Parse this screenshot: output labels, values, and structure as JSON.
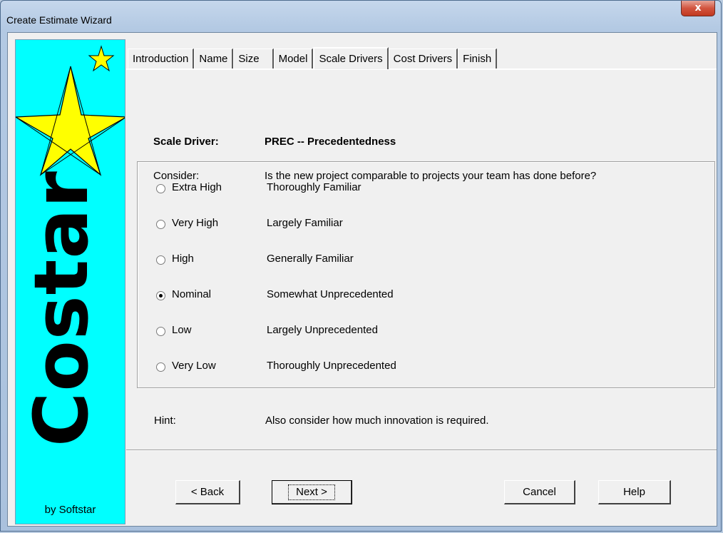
{
  "window": {
    "title": "Create Estimate Wizard",
    "close_glyph": "x"
  },
  "sidebar": {
    "brand": "Costar",
    "byline": "by Softstar",
    "logo_icon": "star-icon",
    "background": "#00ffff",
    "star_color": "#ffff00"
  },
  "tabs": [
    {
      "label": "Introduction"
    },
    {
      "label": "Name"
    },
    {
      "label": "Size"
    },
    {
      "label": "Model"
    },
    {
      "label": "Scale Drivers"
    },
    {
      "label": "Cost Drivers"
    },
    {
      "label": "Finish"
    }
  ],
  "active_tab": "Scale Drivers",
  "driver": {
    "label": "Scale Driver:",
    "value": "PREC -- Precedentedness",
    "consider_label": "Consider:",
    "consider_text": "Is the new project comparable to projects your team has done before?"
  },
  "options": [
    {
      "level": "Extra High",
      "description": "Thoroughly Familiar",
      "checked": false
    },
    {
      "level": "Very High",
      "description": "Largely Familiar",
      "checked": false
    },
    {
      "level": "High",
      "description": "Generally Familiar",
      "checked": false
    },
    {
      "level": "Nominal",
      "description": "Somewhat Unprecedented",
      "checked": true
    },
    {
      "level": "Low",
      "description": "Largely Unprecedented",
      "checked": false
    },
    {
      "level": "Very Low",
      "description": "Thoroughly Unprecedented",
      "checked": false
    }
  ],
  "hint": {
    "label": "Hint:",
    "text": "Also consider how much innovation is required."
  },
  "buttons": {
    "back": "< Back",
    "next": "Next >",
    "cancel": "Cancel",
    "help": "Help"
  }
}
